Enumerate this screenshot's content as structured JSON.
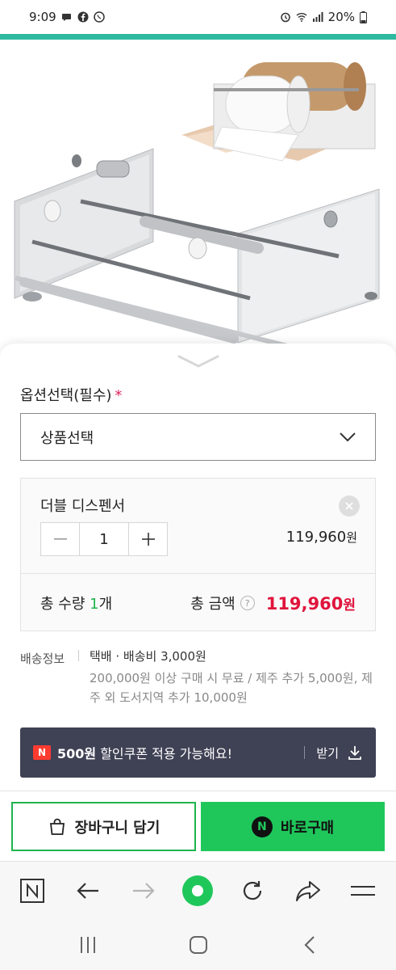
{
  "status_bar": {
    "time": "9:09",
    "battery": "20%"
  },
  "product": {
    "image_alt": "double paper roll dispenser"
  },
  "option": {
    "label": "옵션선택(필수)",
    "required_mark": "*",
    "select_placeholder": "상품선택"
  },
  "selected_item": {
    "name": "더블 디스펜서",
    "quantity": "1",
    "price": "119,960",
    "price_unit": "원"
  },
  "total": {
    "qty_prefix": "총 수량 ",
    "qty_value": "1",
    "qty_suffix": "개",
    "amount_label": "총 금액",
    "help": "?",
    "amount": "119,960",
    "amount_unit": "원"
  },
  "shipping": {
    "label": "배송정보",
    "main": "택배 · 배송비 3,000원",
    "sub": "200,000원 이상 구매 시 무료 / 제주 추가 5,000원, 제주 외 도서지역 추가 10,000원"
  },
  "coupon": {
    "badge": "N",
    "amount": "500원",
    "text": " 할인쿠폰 적용 가능해요!",
    "action": "받기"
  },
  "actions": {
    "cart_label": "장바구니 담기",
    "buy_label": "바로구매",
    "buy_badge": "N"
  },
  "colors": {
    "brand_green": "#1fc75b",
    "price_red": "#e0143c",
    "coupon_bg": "#3f4154",
    "top_strip": "#2fb9a0"
  },
  "browser_toolbar": {
    "items": [
      "home-n-icon",
      "back-icon",
      "forward-icon",
      "green-dot-icon",
      "refresh-icon",
      "share-icon",
      "menu-icon"
    ]
  },
  "system_nav": {
    "items": [
      "recents-icon",
      "home-icon",
      "back-icon"
    ]
  }
}
